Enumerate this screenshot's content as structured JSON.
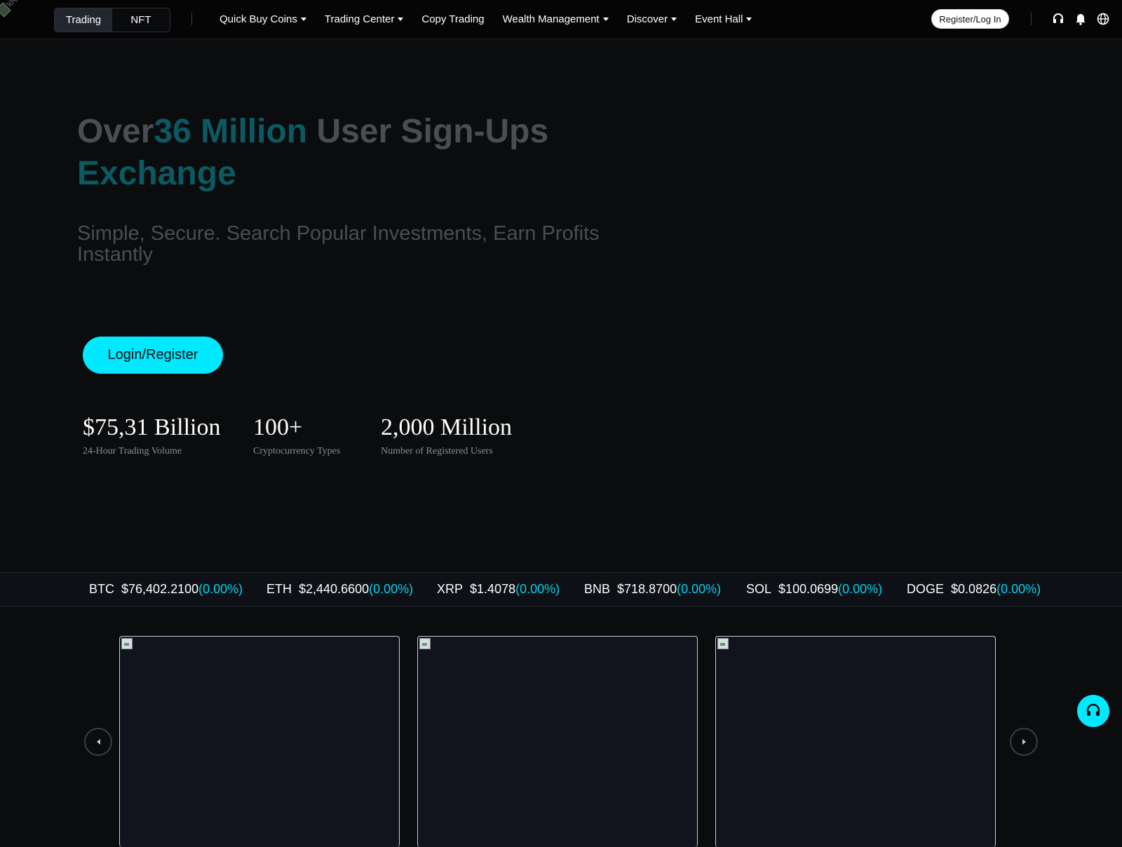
{
  "header": {
    "logo_text": "logo",
    "mode_tabs": [
      {
        "label": "Trading",
        "active": true
      },
      {
        "label": "NFT",
        "active": false
      }
    ],
    "nav_items": [
      {
        "label": "Quick Buy Coins",
        "has_dropdown": true
      },
      {
        "label": "Trading Center",
        "has_dropdown": true
      },
      {
        "label": "Copy Trading",
        "has_dropdown": false
      },
      {
        "label": "Wealth Management",
        "has_dropdown": true
      },
      {
        "label": "Discover",
        "has_dropdown": true
      },
      {
        "label": "Event Hall",
        "has_dropdown": true
      }
    ],
    "register_label": "Register/Log In",
    "icons": [
      "headset-icon",
      "bell-icon",
      "globe-icon"
    ]
  },
  "hero": {
    "title_prefix": "Over",
    "title_highlight": "36 Million",
    "title_suffix": " User Sign-Ups",
    "title_line2": "Exchange",
    "subtitle": "Simple, Secure. Search Popular Investments, Earn Profits Instantly",
    "cta_label": "Login/Register"
  },
  "stats": [
    {
      "value": "$75,31 Billion",
      "label": "24-Hour Trading Volume"
    },
    {
      "value": "100+",
      "label": "Cryptocurrency Types"
    },
    {
      "value": "2,000 Million",
      "label": "Number of Registered Users"
    }
  ],
  "ticker": [
    {
      "symbol": "BTC",
      "price": "$76,402.2100",
      "change": "(0.00%)"
    },
    {
      "symbol": "ETH",
      "price": "$2,440.6600",
      "change": "(0.00%)"
    },
    {
      "symbol": "XRP",
      "price": "$1.4078",
      "change": "(0.00%)"
    },
    {
      "symbol": "BNB",
      "price": "$718.8700",
      "change": "(0.00%)"
    },
    {
      "symbol": "SOL",
      "price": "$100.0699",
      "change": "(0.00%)"
    },
    {
      "symbol": "DOGE",
      "price": "$0.0826",
      "change": "(0.00%)"
    }
  ],
  "colors": {
    "accent": "#00e9ff",
    "accent_dark": "#0b5a62",
    "background": "#0b0c0e"
  }
}
